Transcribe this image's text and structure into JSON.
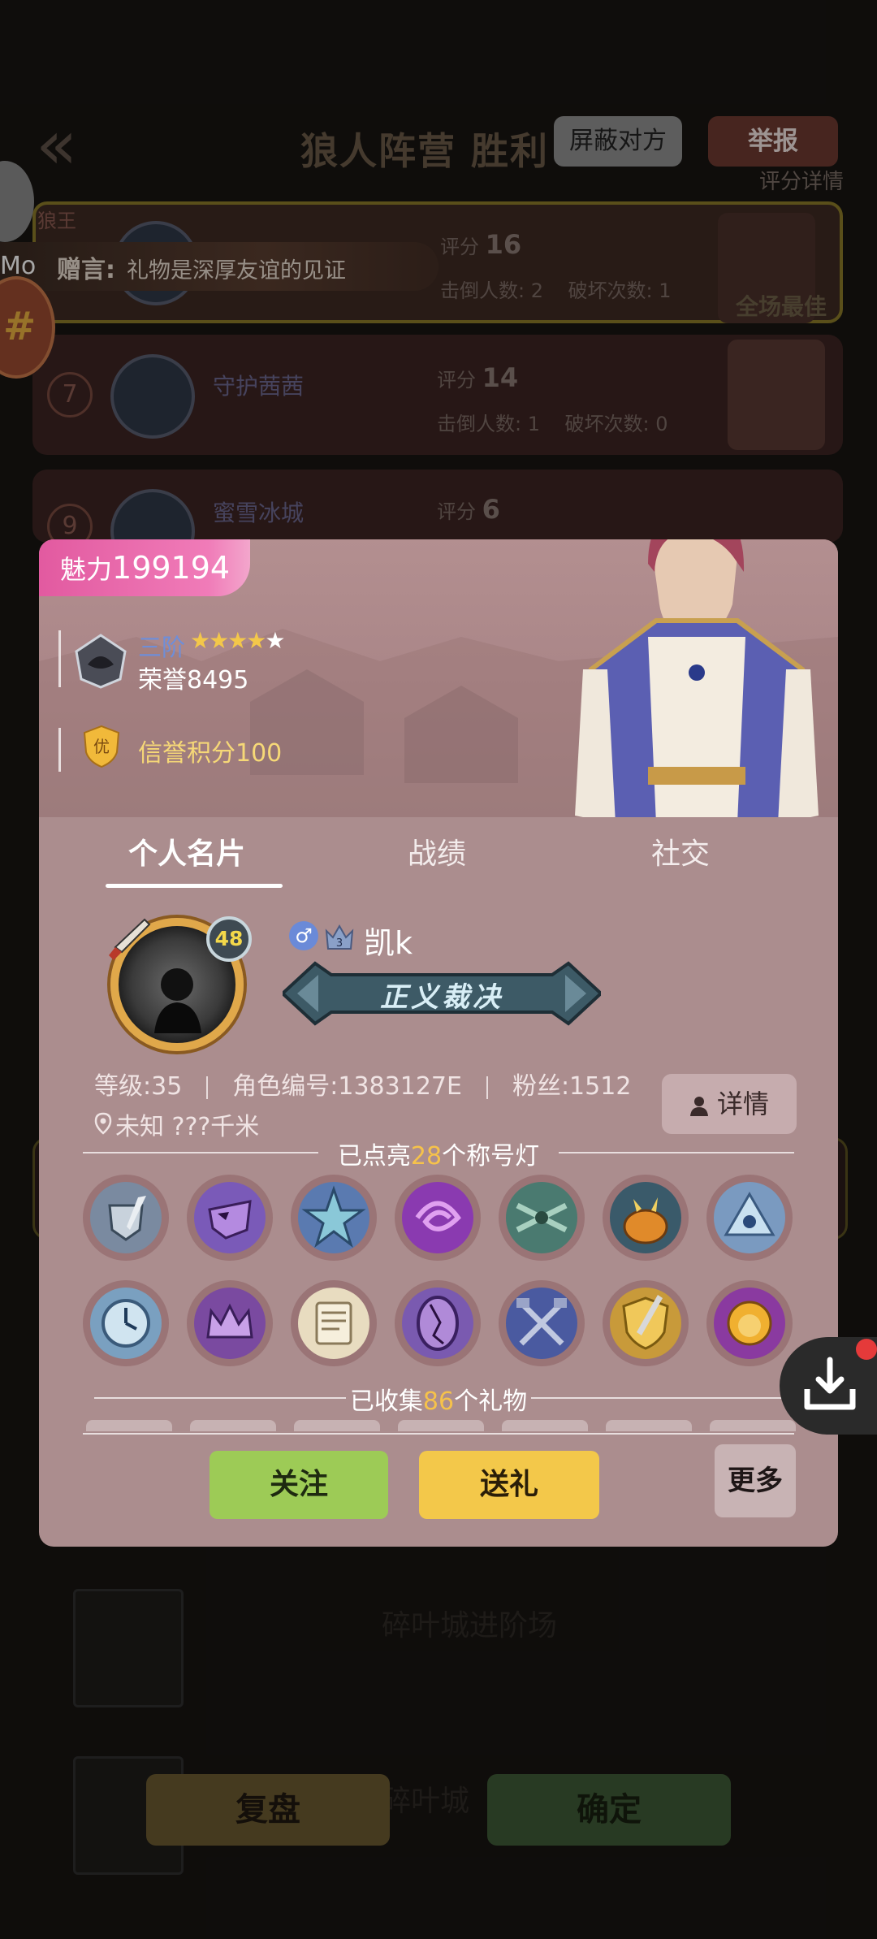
{
  "background": {
    "title": "狼人阵营 胜利",
    "block_button": "屏蔽对方",
    "report_button": "举报",
    "score_detail_link": "评分详情",
    "gift_banner": {
      "label": "赠言:",
      "text": "礼物是深厚友谊的见证"
    },
    "side_user": "Mo",
    "wolf_label": "狼王",
    "best_row": {
      "score_label": "评分",
      "score": "16",
      "kills_label": "击倒人数:",
      "kills": "2",
      "breaks_label": "破坏次数:",
      "breaks": "1",
      "best_tag": "全场最佳"
    },
    "rows": [
      {
        "rank": "7",
        "name": "守护茜茜",
        "score_label": "评分",
        "score": "14",
        "kills_label": "击倒人数:",
        "kills": "1",
        "breaks_label": "破坏次数:",
        "breaks": "0"
      },
      {
        "rank": "9",
        "name": "蜜雪冰城",
        "score_label": "评分",
        "score": "6"
      }
    ],
    "bottom_lines": [
      "碎叶城进阶场",
      "碎叶城"
    ],
    "replay_button": "复盘",
    "confirm_button": "确定"
  },
  "profile": {
    "charm_label": "魅力",
    "charm_value": "199194",
    "rank_tier": "三阶",
    "stars_filled": 4,
    "stars_total": 5,
    "honor_label": "荣誉",
    "honor_value": "8495",
    "credit_badge": "优",
    "credit_text": "信誉积分100",
    "tabs": [
      "个人名片",
      "战绩",
      "社交"
    ],
    "active_tab": 0,
    "level_bubble": "48",
    "nickname": "凯k",
    "vip_level": "3",
    "title_banner": "正义裁决",
    "level_text": "等级:35",
    "role_id_text": "角色编号:1383127E",
    "fans_text": "粉丝:1512",
    "location_text": "未知  ???千米",
    "detail_button": "详情",
    "lit_titles": {
      "before": "已点亮",
      "count": "28",
      "after": "个称号灯"
    },
    "gifts_collected": {
      "before": "已收集",
      "count": "86",
      "after": "个礼物"
    },
    "badges": [
      "shield-sword-badge",
      "purple-mask-badge",
      "blue-star-badge",
      "purple-vortex-badge",
      "crossbow-badge",
      "pumpkin-badge",
      "blue-eye-badge",
      "clock-badge",
      "purple-crown-badge",
      "scroll-badge",
      "cracked-mirror-badge",
      "crossed-hammers-badge",
      "gold-shield-badge",
      "lion-badge"
    ],
    "follow_button": "关注",
    "gift_button": "送礼",
    "more_button": "更多"
  },
  "colors": {
    "card_bg": "#ab8d8e",
    "charm_pink": "#e25aa0",
    "follow_green": "#9dcb56",
    "gift_yellow": "#f3c84a",
    "highlight_number": "#f6c24a"
  }
}
